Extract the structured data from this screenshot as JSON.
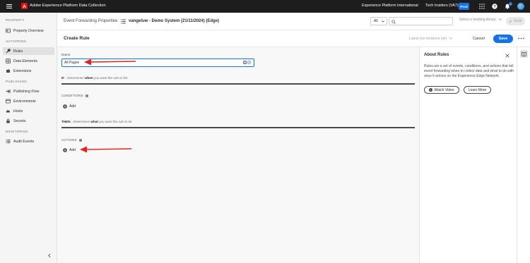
{
  "topbar": {
    "app_title": "Adobe Experience Platform Data Collection",
    "org_name": "Experience Platform International",
    "sandbox_name": "Tech Insiders (VA7)",
    "env_badge": "Prod",
    "notification_count": "1"
  },
  "sidebar": {
    "sections": {
      "property": "PROPERTY",
      "authoring": "AUTHORING",
      "publishing": "PUBLISHING",
      "monitoring": "MONITORING"
    },
    "items": {
      "property_overview": "Property Overview",
      "rules": "Rules",
      "data_elements": "Data Elements",
      "extensions": "Extensions",
      "publishing_flow": "Publishing Flow",
      "environments": "Environments",
      "hosts": "Hosts",
      "secrets": "Secrets",
      "audit_events": "Audit Events"
    },
    "active_item": "rules"
  },
  "header": {
    "breadcrumb_root": "Event Forwarding Properties",
    "breadcrumb_separator": "›",
    "property_name": "vangeluw - Demo System (21/11/2024) (Edge)",
    "filter_value": "All",
    "search_placeholder": "",
    "library_placeholder": "Select a working library",
    "build_label": "Build"
  },
  "rule": {
    "page_title": "Create Rule",
    "revision_label": "Latest (no revisions yet)",
    "cancel_label": "Cancel",
    "save_label": "Save",
    "name_label": "Name",
    "name_value": "All Pages",
    "if_prefix": "IF",
    "if_text_1": " - Determines ",
    "if_text_bold": "when",
    "if_text_2": " you want the rule to fire",
    "conditions_label": "CONDITIONS",
    "then_prefix": "THEN",
    "then_text_1": " - Determines ",
    "then_text_bold": "what",
    "then_text_2": " you want the rule to do",
    "actions_label": "ACTIONS",
    "add_label": "Add"
  },
  "about": {
    "title": "About Rules",
    "body": "Rules are a set of events, conditions, and actions that tell event forwarding when to collect data and what to do with once it arrives on the Experience Edge Network.",
    "watch_video_label": "Watch Video",
    "learn_more_label": "Learn More"
  },
  "colors": {
    "accent": "#1473e6",
    "topbar": "#1d1d1d",
    "annotation": "#e8211a"
  }
}
